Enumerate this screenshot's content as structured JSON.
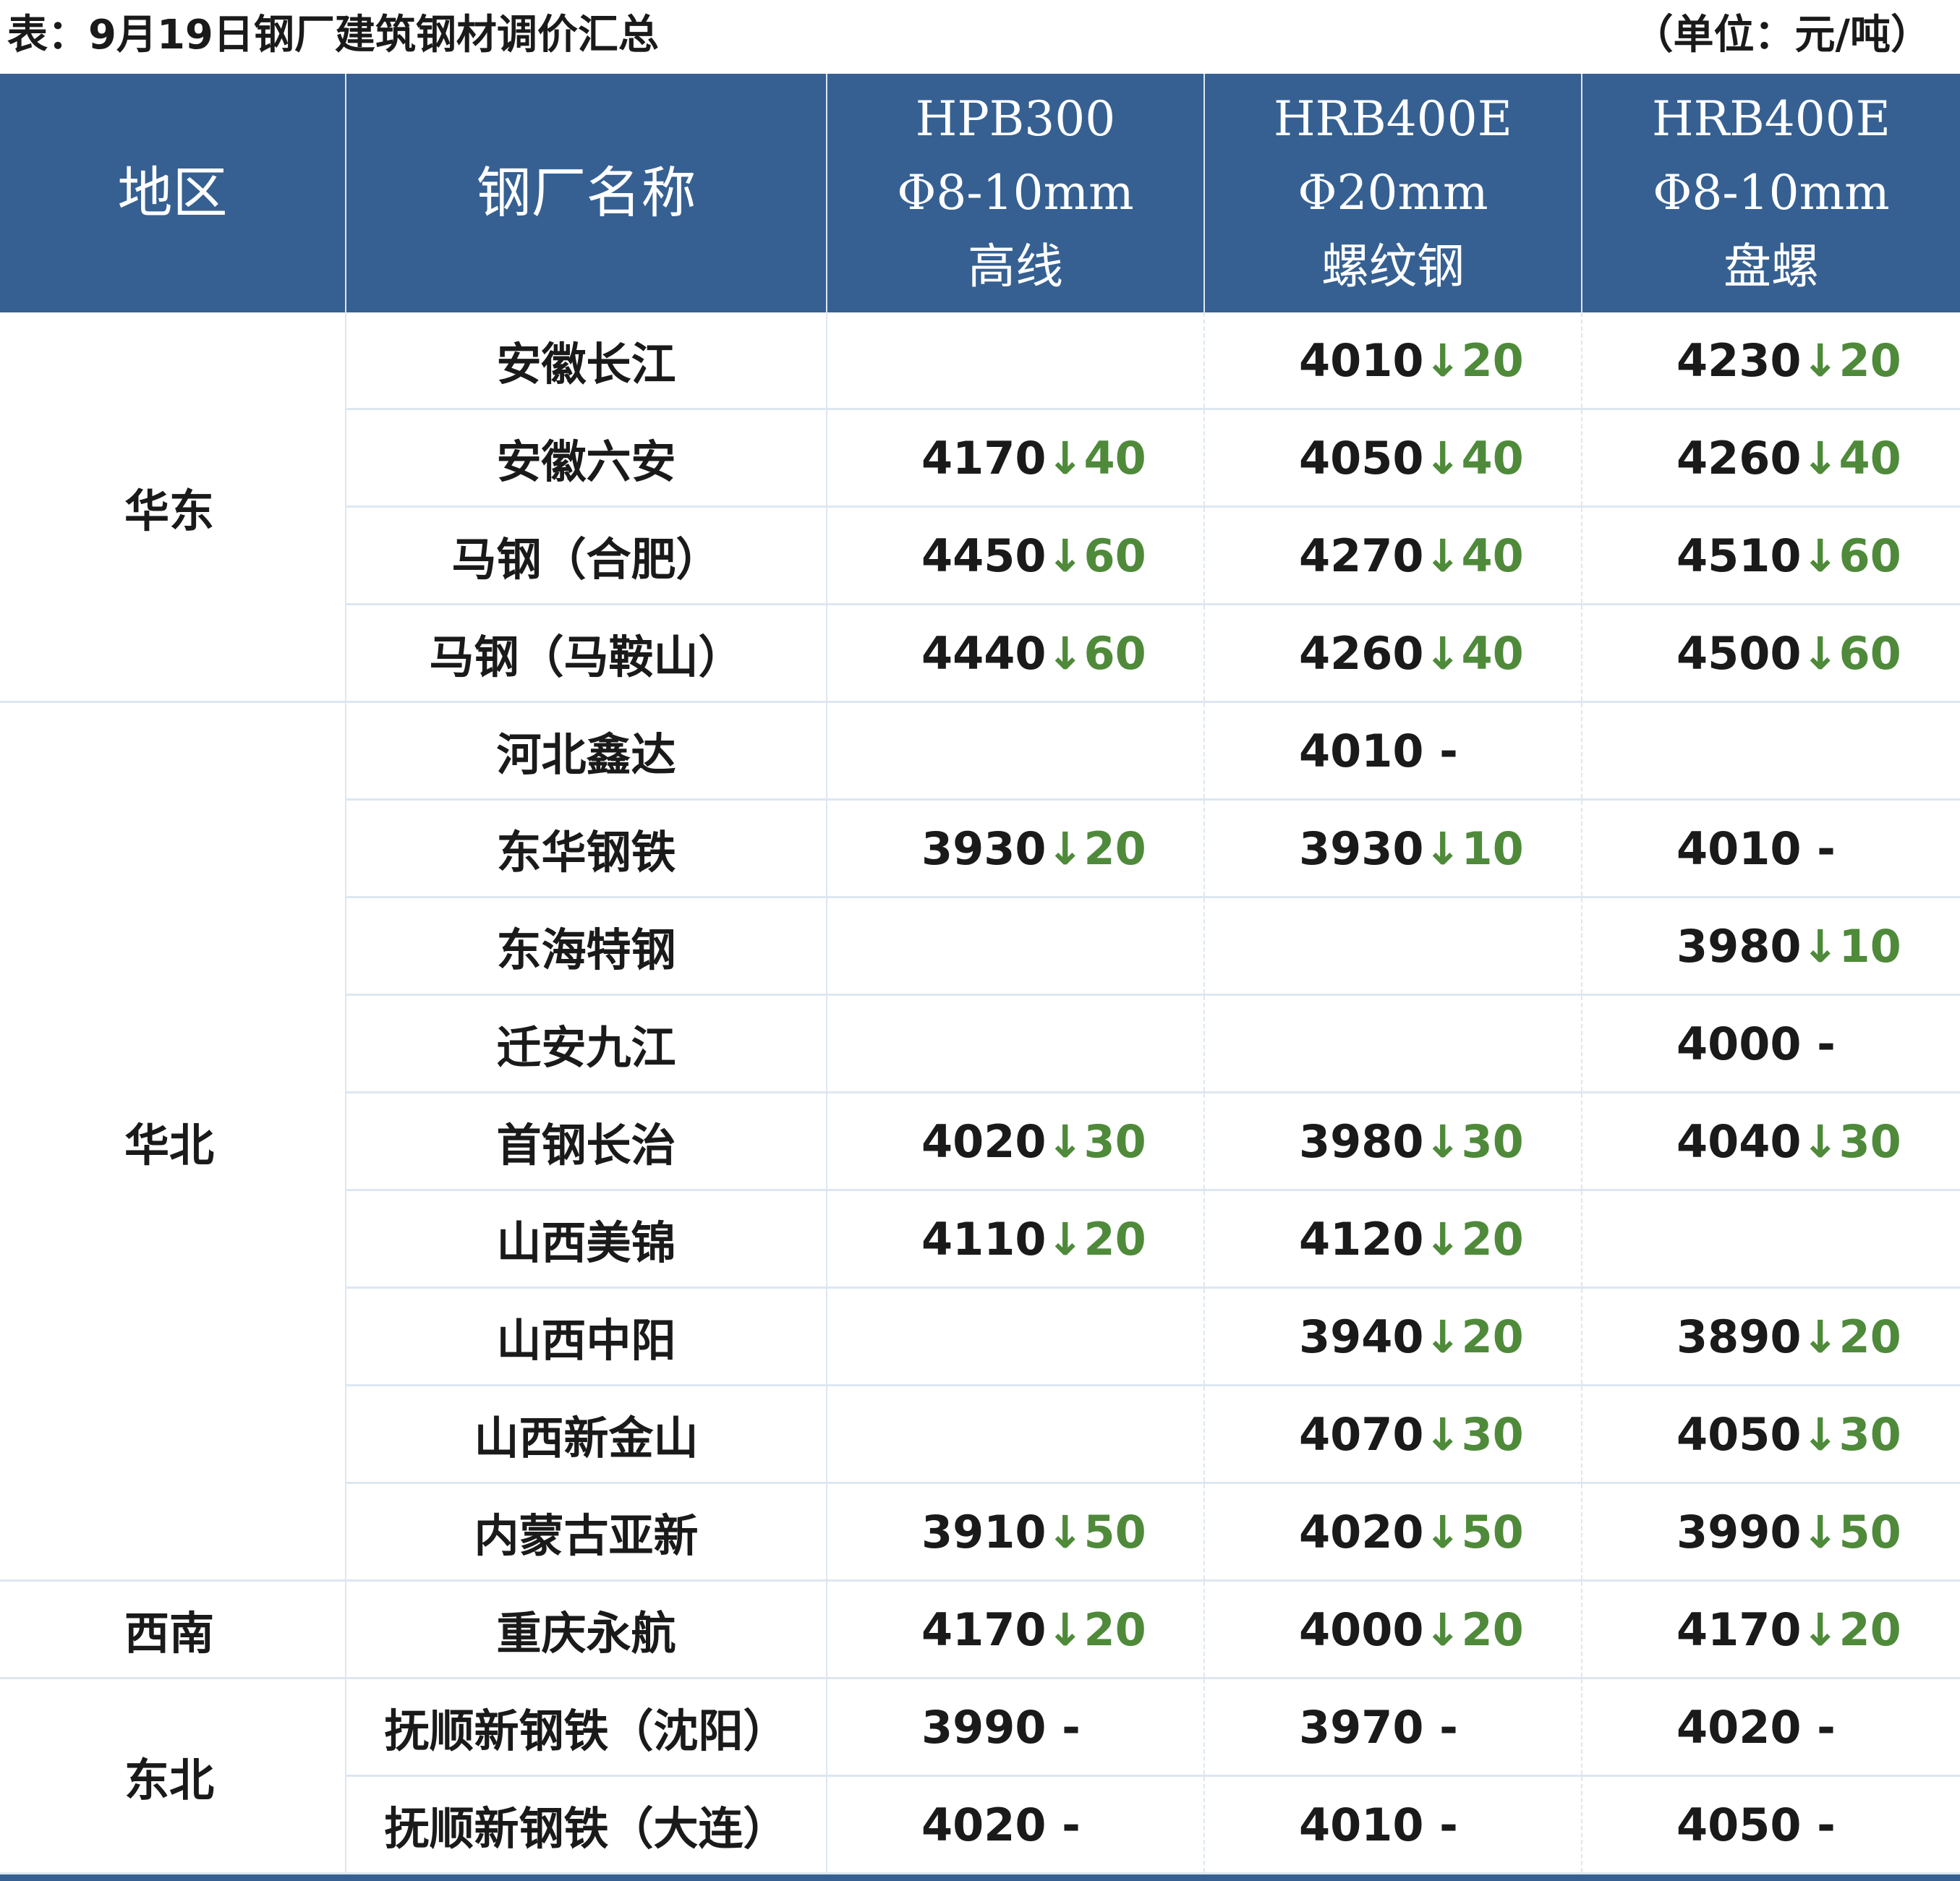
{
  "caption": {
    "title": "表：9月19日钢厂建筑钢材调价汇总",
    "unit": "（单位：元/吨）"
  },
  "headers": {
    "region": "地区",
    "mill": "钢厂名称",
    "col_a": [
      "HPB300",
      "Φ8-10mm",
      "高线"
    ],
    "col_b": [
      "HRB400E",
      "Φ20mm",
      "螺纹钢"
    ],
    "col_c": [
      "HRB400E",
      "Φ8-10mm",
      "盘螺"
    ]
  },
  "groups": [
    {
      "region": "华东",
      "rows": [
        {
          "mill": "安徽长江",
          "a": null,
          "b": {
            "price": "4010",
            "chg": "↓20"
          },
          "c": {
            "price": "4230",
            "chg": "↓20"
          }
        },
        {
          "mill": "安徽六安",
          "a": {
            "price": "4170",
            "chg": "↓40"
          },
          "b": {
            "price": "4050",
            "chg": "↓40"
          },
          "c": {
            "price": "4260",
            "chg": "↓40"
          }
        },
        {
          "mill": "马钢（合肥）",
          "a": {
            "price": "4450",
            "chg": "↓60"
          },
          "b": {
            "price": "4270",
            "chg": "↓40"
          },
          "c": {
            "price": "4510",
            "chg": "↓60"
          }
        },
        {
          "mill": "马钢（马鞍山）",
          "a": {
            "price": "4440",
            "chg": "↓60"
          },
          "b": {
            "price": "4260",
            "chg": "↓40"
          },
          "c": {
            "price": "4500",
            "chg": "↓60"
          }
        }
      ]
    },
    {
      "region": "华北",
      "rows": [
        {
          "mill": "河北鑫达",
          "a": null,
          "b": {
            "price": "4010",
            "chg": "-"
          },
          "c": null
        },
        {
          "mill": "东华钢铁",
          "a": {
            "price": "3930",
            "chg": "↓20"
          },
          "b": {
            "price": "3930",
            "chg": "↓10"
          },
          "c": {
            "price": "4010",
            "chg": "-"
          }
        },
        {
          "mill": "东海特钢",
          "a": null,
          "b": null,
          "c": {
            "price": "3980",
            "chg": "↓10"
          }
        },
        {
          "mill": "迁安九江",
          "a": null,
          "b": null,
          "c": {
            "price": "4000",
            "chg": "-"
          }
        },
        {
          "mill": "首钢长治",
          "a": {
            "price": "4020",
            "chg": "↓30"
          },
          "b": {
            "price": "3980",
            "chg": "↓30"
          },
          "c": {
            "price": "4040",
            "chg": "↓30"
          }
        },
        {
          "mill": "山西美锦",
          "a": {
            "price": "4110",
            "chg": "↓20"
          },
          "b": {
            "price": "4120",
            "chg": "↓20"
          },
          "c": null
        },
        {
          "mill": "山西中阳",
          "a": null,
          "b": {
            "price": "3940",
            "chg": "↓20"
          },
          "c": {
            "price": "3890",
            "chg": "↓20"
          }
        },
        {
          "mill": "山西新金山",
          "a": null,
          "b": {
            "price": "4070",
            "chg": "↓30"
          },
          "c": {
            "price": "4050",
            "chg": "↓30"
          }
        },
        {
          "mill": "内蒙古亚新",
          "a": {
            "price": "3910",
            "chg": "↓50"
          },
          "b": {
            "price": "4020",
            "chg": "↓50"
          },
          "c": {
            "price": "3990",
            "chg": "↓50"
          }
        }
      ]
    },
    {
      "region": "西南",
      "rows": [
        {
          "mill": "重庆永航",
          "a": {
            "price": "4170",
            "chg": "↓20"
          },
          "b": {
            "price": "4000",
            "chg": "↓20"
          },
          "c": {
            "price": "4170",
            "chg": "↓20"
          }
        }
      ]
    },
    {
      "region": "东北",
      "rows": [
        {
          "mill": "抚顺新钢铁（沈阳）",
          "a": {
            "price": "3990",
            "chg": "-"
          },
          "b": {
            "price": "3970",
            "chg": "-"
          },
          "c": {
            "price": "4020",
            "chg": "-"
          }
        },
        {
          "mill": "抚顺新钢铁（大连）",
          "a": {
            "price": "4020",
            "chg": "-"
          },
          "b": {
            "price": "4010",
            "chg": "-"
          },
          "c": {
            "price": "4050",
            "chg": "-"
          }
        }
      ]
    }
  ],
  "colors": {
    "header_bg": "#366092",
    "header_text": "#ffffff",
    "change_down": "#4e8a3a",
    "grid": "#dde7f2"
  }
}
